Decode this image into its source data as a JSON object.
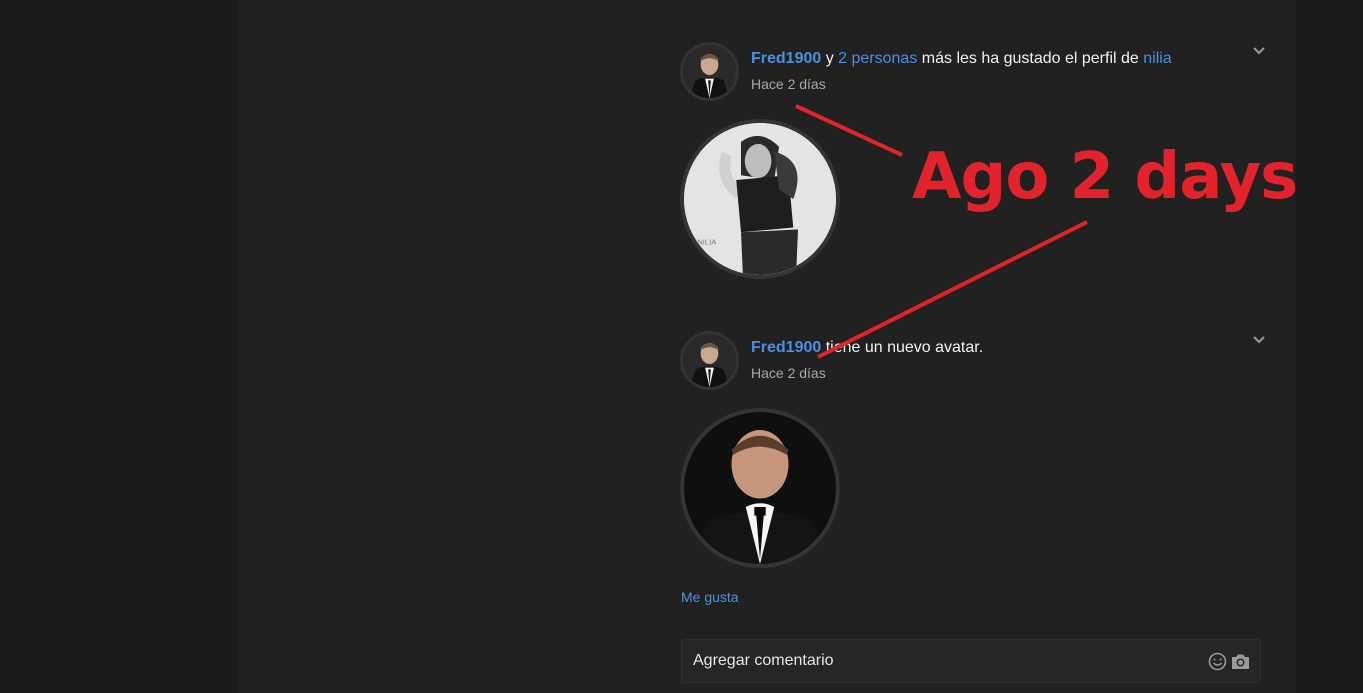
{
  "feed": {
    "items": [
      {
        "actor": "Fred1900",
        "connector": " y ",
        "others": "2 personas",
        "action": " más les ha gustado el perfil de ",
        "target": "nilia",
        "time": "Hace 2 días",
        "chevron_icon": "chevron-down-icon"
      },
      {
        "actor": "Fred1900",
        "action": " tiene un nuevo avatar.",
        "time": "Hace 2 días",
        "chevron_icon": "chevron-down-icon"
      }
    ],
    "like_label": "Me gusta",
    "comment": {
      "placeholder": "Agregar comentario",
      "emoji_icon": "smiley-icon",
      "camera_icon": "camera-icon"
    }
  },
  "annotation": {
    "text": "Ago 2 days",
    "color": "#e3232b"
  },
  "colors": {
    "page_bg": "#1b1b1b",
    "column_bg": "#212121",
    "link": "#4a8fe0",
    "muted": "#a8a8a8"
  }
}
